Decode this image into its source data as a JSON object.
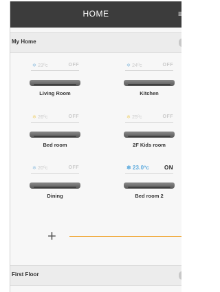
{
  "header": {
    "title": "HOME",
    "menu_glyph": "≡"
  },
  "sections": [
    {
      "label": "My Home"
    },
    {
      "label": "First Floor"
    }
  ],
  "devices": [
    {
      "temp": "23ºc",
      "state": "OFF",
      "name": "Living Room",
      "active": false
    },
    {
      "temp": "24ºc",
      "state": "OFF",
      "name": "Kitchen",
      "active": false
    },
    {
      "temp": "26ºc",
      "state": "OFF",
      "name": "Bed room",
      "active": false
    },
    {
      "temp": "25ºc",
      "state": "OFF",
      "name": "2F Kids room",
      "active": false
    },
    {
      "temp": "20ºc",
      "state": "OFF",
      "name": "Dining",
      "active": false
    },
    {
      "temp": "23.0ºc",
      "state": "ON",
      "name": "Bed room 2",
      "active": true
    }
  ],
  "add_button": {
    "glyph": "+"
  },
  "colors": {
    "header_bg": "#3c3c3c",
    "accent_orange": "#f0a93a",
    "active_blue": "#5aa9dd"
  },
  "icons": {
    "mode": "snowflake-icon",
    "menu": "menu-icon",
    "add": "plus-icon"
  }
}
